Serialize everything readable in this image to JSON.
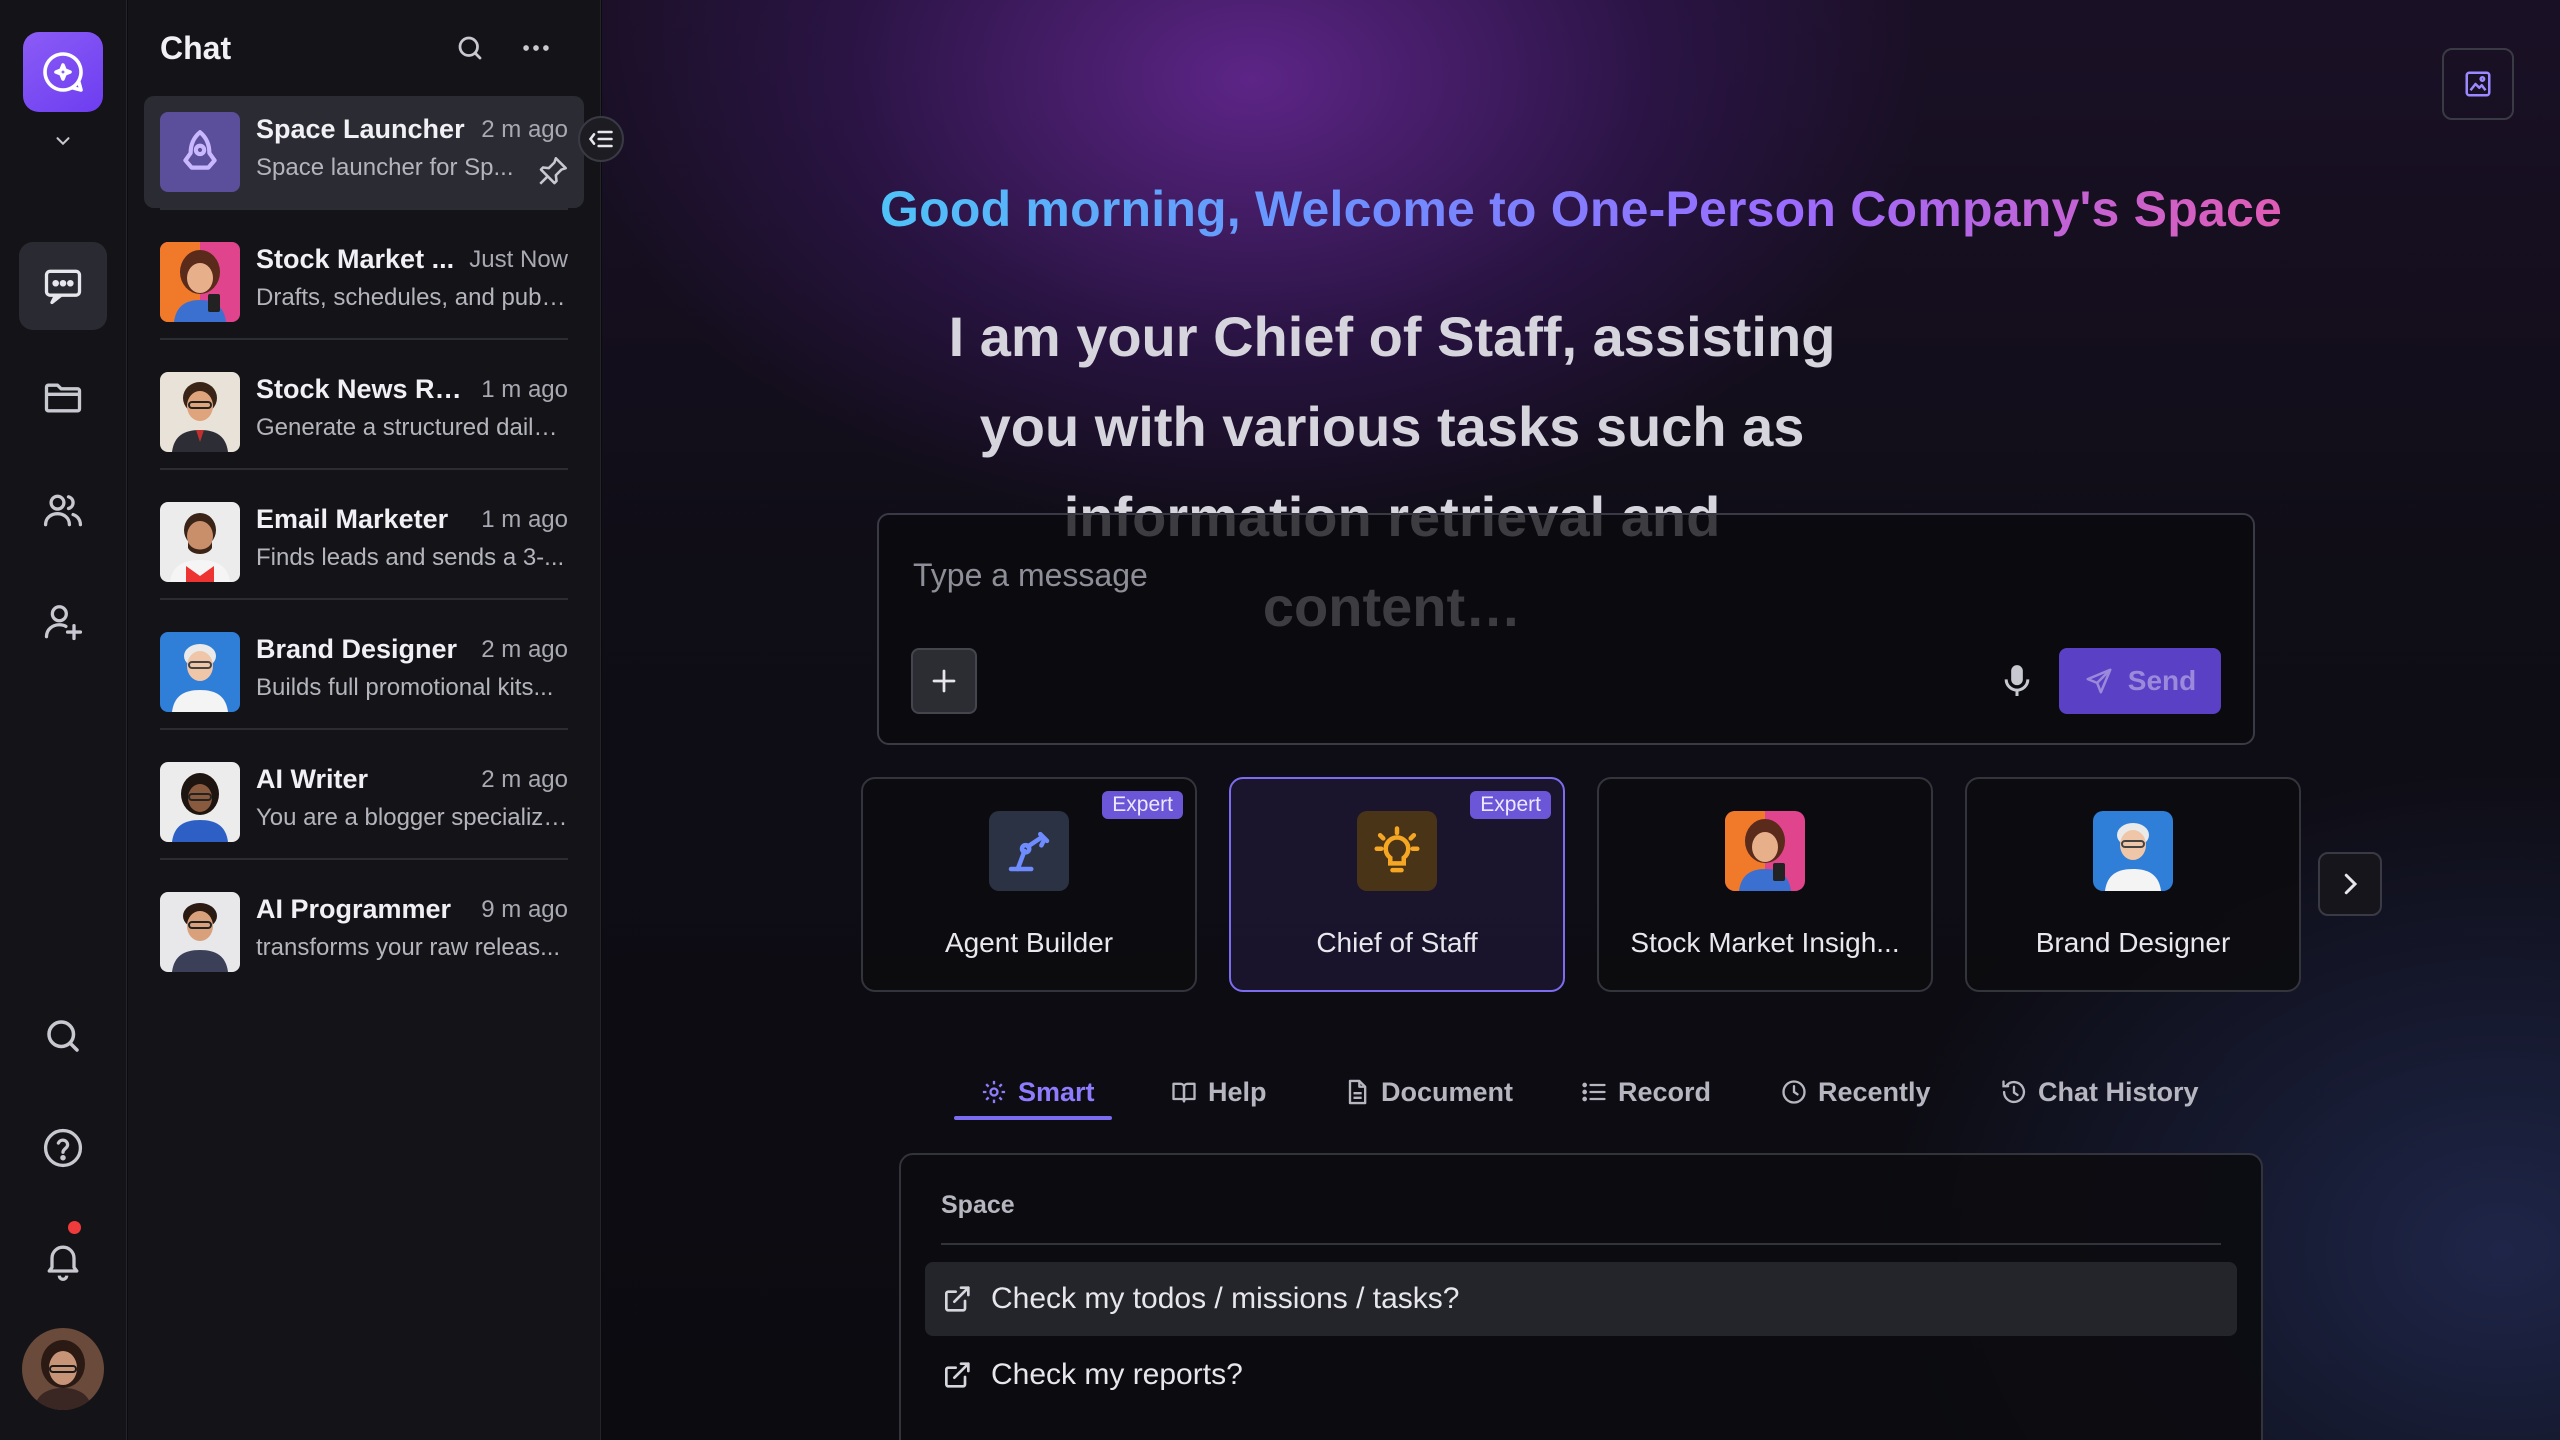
{
  "rail": {
    "logo_icon": "chat-sparkle-icon",
    "items": [
      {
        "icon": "chat-icon",
        "active": true
      },
      {
        "icon": "folder-icon"
      },
      {
        "icon": "users-icon"
      },
      {
        "icon": "user-add-icon"
      },
      {
        "icon": "search-icon"
      },
      {
        "icon": "help-icon"
      },
      {
        "icon": "bell-icon",
        "notification": true
      }
    ]
  },
  "panel": {
    "title": "Chat",
    "chats": [
      {
        "name": "Space Launcher",
        "time": "2 m ago",
        "desc": "Space launcher for Sp...",
        "pinned": true
      },
      {
        "name": "Stock Market ...",
        "time": "Just Now",
        "desc": "Drafts, schedules, and publi..."
      },
      {
        "name": "Stock News Re...",
        "time": "1 m ago",
        "desc": "Generate a structured daily ..."
      },
      {
        "name": "Email Marketer",
        "time": "1 m ago",
        "desc": "Finds leads and sends a 3-..."
      },
      {
        "name": "Brand Designer",
        "time": "2 m ago",
        "desc": "Builds full promotional kits..."
      },
      {
        "name": "AI Writer",
        "time": "2 m ago",
        "desc": "You are a blogger specializi..."
      },
      {
        "name": "AI Programmer",
        "time": "9 m ago",
        "desc": "transforms your raw releas..."
      }
    ]
  },
  "main": {
    "greeting": "Good morning, Welcome to One-Person Company's Space",
    "tagline": "I am your Chief of Staff, assisting you with various tasks such as information retrieval and content…",
    "composer": {
      "placeholder": "Type a message",
      "send_label": "Send"
    },
    "agents": [
      {
        "label": "Agent Builder",
        "badge": "Expert",
        "icon": "robot-arm-icon"
      },
      {
        "label": "Chief of Staff",
        "badge": "Expert",
        "icon": "lightbulb-icon",
        "active": true
      },
      {
        "label": "Stock Market Insigh...",
        "badge": "",
        "icon": "avatar-woman-phone"
      },
      {
        "label": "Brand Designer",
        "badge": "",
        "icon": "avatar-old-man"
      }
    ],
    "tabs": [
      {
        "label": "Smart",
        "icon": "gear-icon",
        "active": true
      },
      {
        "label": "Help",
        "icon": "book-icon"
      },
      {
        "label": "Document",
        "icon": "document-icon"
      },
      {
        "label": "Record",
        "icon": "list-icon"
      },
      {
        "label": "Recently",
        "icon": "clock-icon"
      },
      {
        "label": "Chat History",
        "icon": "history-icon"
      }
    ],
    "suggestions": {
      "heading": "Space",
      "items": [
        "Check my todos / missions / tasks?",
        "Check my reports?"
      ]
    }
  },
  "colors": {
    "accent": "#7b6cf0",
    "send_button": "#5a40c4",
    "badge": "#6b56d8",
    "notification": "#ef3b3b"
  }
}
